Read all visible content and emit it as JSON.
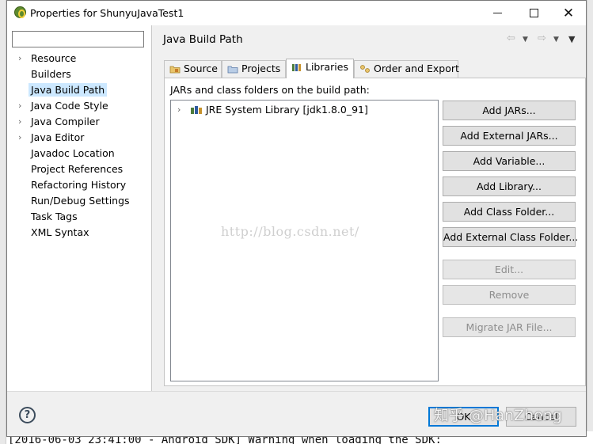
{
  "window": {
    "title": "Properties for ShunyuJavaTest1",
    "minimize_symbol": "",
    "close_symbol": "✕"
  },
  "left_pane": {
    "filter_value": "",
    "items": [
      {
        "label": "Resource",
        "expandable": true
      },
      {
        "label": "Builders",
        "expandable": false
      },
      {
        "label": "Java Build Path",
        "expandable": false,
        "selected": true
      },
      {
        "label": "Java Code Style",
        "expandable": true
      },
      {
        "label": "Java Compiler",
        "expandable": true
      },
      {
        "label": "Java Editor",
        "expandable": true
      },
      {
        "label": "Javadoc Location",
        "expandable": false
      },
      {
        "label": "Project References",
        "expandable": false
      },
      {
        "label": "Refactoring History",
        "expandable": false
      },
      {
        "label": "Run/Debug Settings",
        "expandable": false
      },
      {
        "label": "Task Tags",
        "expandable": false
      },
      {
        "label": "XML Syntax",
        "expandable": false
      }
    ]
  },
  "right_pane": {
    "header": "Java Build Path",
    "tabs": {
      "source": "Source",
      "projects": "Projects",
      "libraries": "Libraries",
      "order": "Order and Export"
    },
    "active_tab": "Libraries",
    "jars_label": "JARs and class folders on the build path:",
    "tree": {
      "row1": "JRE System Library [jdk1.8.0_91]"
    },
    "watermark": "http://blog.csdn.net/",
    "buttons": {
      "add_jars": "Add JARs...",
      "add_external_jars": "Add External JARs...",
      "add_variable": "Add Variable...",
      "add_library": "Add Library...",
      "add_class_folder": "Add Class Folder...",
      "add_external_class_folder": "Add External Class Folder...",
      "edit": "Edit...",
      "remove": "Remove",
      "migrate": "Migrate JAR File..."
    }
  },
  "footer": {
    "help": "?",
    "ok": "OK",
    "cancel": "Cancel"
  },
  "overlay_watermark": "知乎 @HanZheng",
  "console_line": "[2016-06-03 23:41:00 - Android SDK] Warning when loading the SDK:",
  "colors": {
    "selection": "#cce8ff",
    "default_button_border": "#0078d7",
    "button_face": "#e1e1e1"
  }
}
